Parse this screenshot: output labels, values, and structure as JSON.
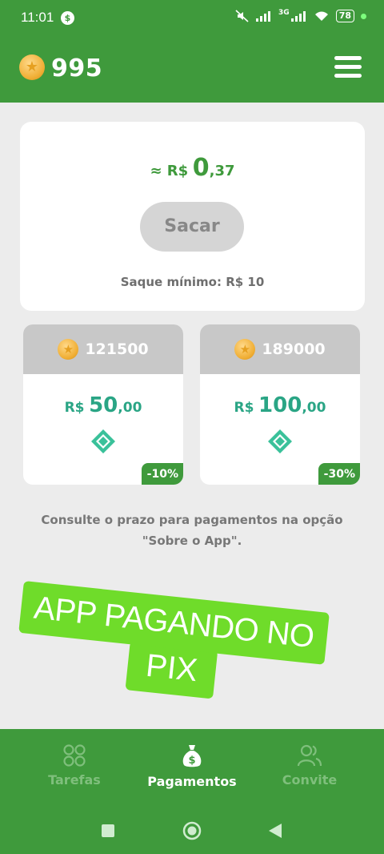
{
  "status_bar": {
    "time": "11:01",
    "app_badge": "$",
    "network": "3G",
    "battery": "78"
  },
  "header": {
    "coin_balance": "995",
    "colors": {
      "primary": "#3f9a3c",
      "accent": "#2aa585"
    }
  },
  "withdraw_card": {
    "approx": "≈ R$",
    "amount_int": "0",
    "amount_dec": ",37",
    "button_label": "Sacar",
    "minimum_text": "Saque mínimo: R$ 10"
  },
  "options": [
    {
      "coins": "121500",
      "currency": "R$",
      "amount_int": "50",
      "amount_dec": ",00",
      "discount": "-10%",
      "icon": "pix-icon"
    },
    {
      "coins": "189000",
      "currency": "R$",
      "amount_int": "100",
      "amount_dec": ",00",
      "discount": "-30%",
      "icon": "pix-icon"
    }
  ],
  "info_text": "Consulte o prazo para pagamentos na opção \"Sobre o App\".",
  "promo": {
    "line1": "APP PAGANDO NO",
    "line2": "PIX"
  },
  "bottom_nav": [
    {
      "label": "Tarefas",
      "icon": "grid-icon",
      "active": false
    },
    {
      "label": "Pagamentos",
      "icon": "money-bag-icon",
      "active": true
    },
    {
      "label": "Convite",
      "icon": "users-icon",
      "active": false
    }
  ]
}
